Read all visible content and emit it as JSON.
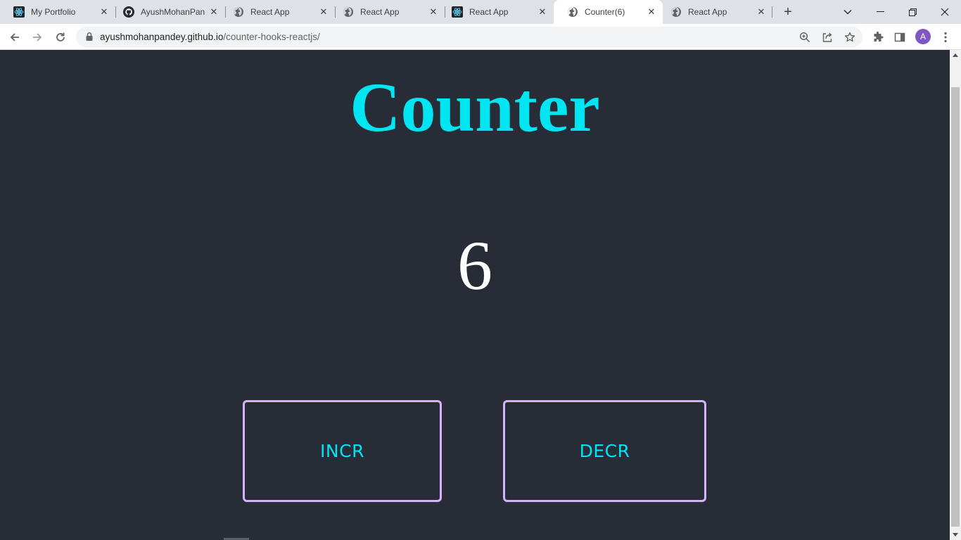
{
  "browser": {
    "tabs": [
      {
        "title": "My Portfolio",
        "icon": "react-icon"
      },
      {
        "title": "AyushMohanPan",
        "icon": "github-icon"
      },
      {
        "title": "React App",
        "icon": "globe-icon"
      },
      {
        "title": "React App",
        "icon": "globe-icon"
      },
      {
        "title": "React App",
        "icon": "react-icon"
      },
      {
        "title": "Counter(6)",
        "icon": "globe-icon",
        "active": true
      },
      {
        "title": "React App",
        "icon": "globe-icon"
      }
    ],
    "address": {
      "host": "ayushmohanpandey.github.io",
      "path": "/counter-hooks-reactjs/"
    },
    "profile_initial": "A"
  },
  "page": {
    "heading": "Counter",
    "count": "6",
    "incr_label": "INCR",
    "decr_label": "DECR"
  },
  "colors": {
    "page_bg": "#282c37",
    "accent": "#00e5f2",
    "button_border": "#d3b3ff",
    "count_text": "#ffffff"
  }
}
